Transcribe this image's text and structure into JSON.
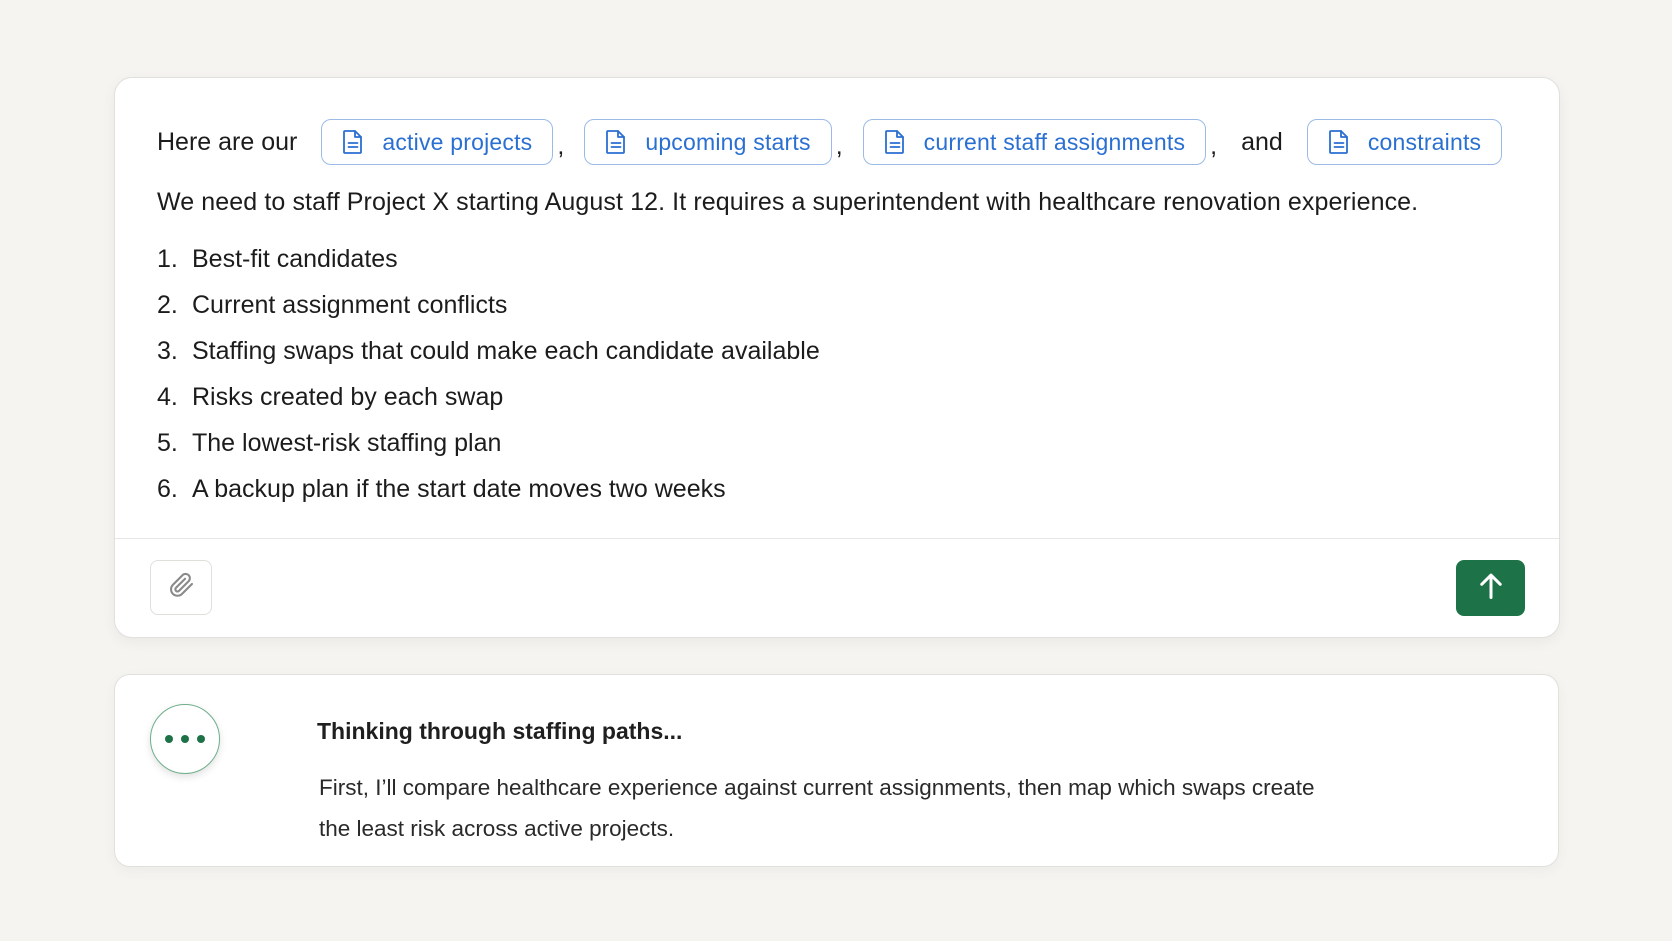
{
  "composer": {
    "intro": "Here are our",
    "chips": [
      {
        "label": "active projects",
        "icon": "document-icon"
      },
      {
        "label": "upcoming starts",
        "icon": "document-icon"
      },
      {
        "label": "current staff assignments",
        "icon": "document-icon"
      },
      {
        "label": "constraints",
        "icon": "document-icon"
      }
    ],
    "separators": {
      "comma": ",",
      "and": "and"
    },
    "request": "We need to staff Project X starting August 12. It requires a superintendent with healthcare renovation experience.",
    "steps": [
      {
        "num": "1.",
        "text": "Best-fit candidates"
      },
      {
        "num": "2.",
        "text": "Current assignment conflicts"
      },
      {
        "num": "3.",
        "text": "Staffing swaps that could make each candidate available"
      },
      {
        "num": "4.",
        "text": "Risks created by each swap"
      },
      {
        "num": "5.",
        "text": "The lowest-risk staffing plan"
      },
      {
        "num": "6.",
        "text": "A backup plan if the start date moves two weeks"
      }
    ],
    "attach_icon": "paperclip-icon",
    "send_icon": "arrow-up-icon"
  },
  "thinking": {
    "indicator_icon": "ellipsis-icon",
    "title": "Thinking through staffing paths...",
    "text": "First, I’ll compare healthcare experience against current assignments, then map which swaps create the least risk across active projects."
  },
  "colors": {
    "background": "#f5f4f1",
    "chip_text": "#2a6fd2",
    "chip_border": "#9bbbe6",
    "send_button": "#1d7247",
    "thinking_dots": "#1d7247"
  }
}
